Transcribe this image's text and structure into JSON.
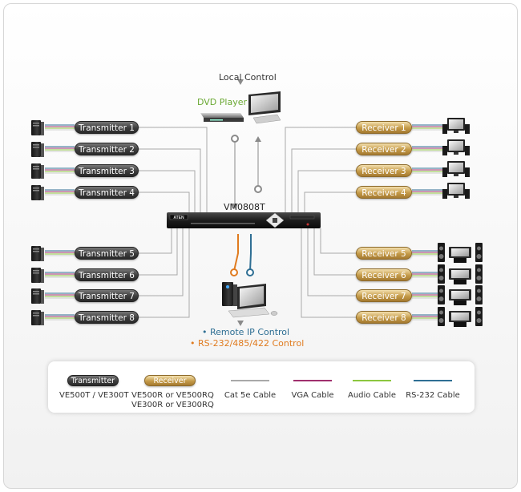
{
  "local_control": "Local Control",
  "dvd_player": "DVD Player",
  "switch_model": "VM0808T",
  "remote_ip_control": "Remote IP Control",
  "rs232_control": "RS-232/485/422 Control",
  "transmitters": [
    "Transmitter 1",
    "Transmitter 2",
    "Transmitter 3",
    "Transmitter 4",
    "Transmitter 5",
    "Transmitter 6",
    "Transmitter 7",
    "Transmitter 8"
  ],
  "receivers": [
    "Receiver 1",
    "Receiver 2",
    "Receiver 3",
    "Receiver 4",
    "Receiver 5",
    "Receiver 6",
    "Receiver 7",
    "Receiver 8"
  ],
  "legend": {
    "transmitter_pill": "Transmitter",
    "transmitter_caption": "VE500T / VE300T",
    "receiver_pill": "Receiver",
    "receiver_caption_1": "VE500R or VE500RQ",
    "receiver_caption_2": "VE300R or VE300RQ",
    "cat5e": "Cat 5e Cable",
    "vga": "VGA Cable",
    "audio": "Audio Cable",
    "rs232": "RS-232 Cable"
  },
  "colors": {
    "cat5e": "#a9a9a9",
    "vga": "#a0306e",
    "audio": "#8cc63f",
    "rs232": "#2f6f94",
    "remote_ip": "#2f6f94",
    "rs232_control": "#e07b1f",
    "transmitter": "#3a3a3a",
    "receiver": "#c49a48"
  },
  "switch_brand": "ATEN"
}
